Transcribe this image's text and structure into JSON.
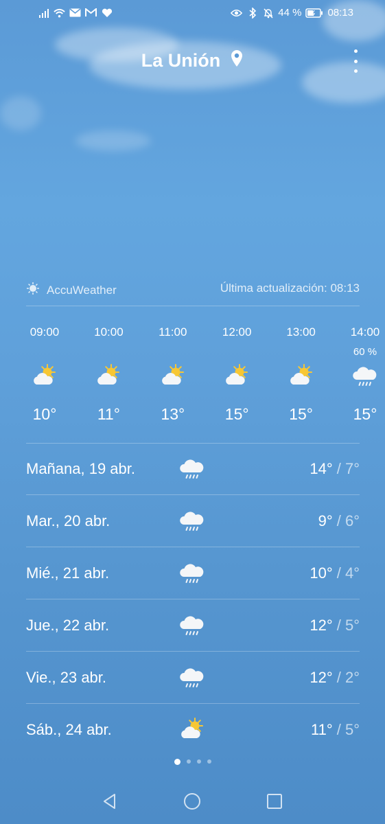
{
  "status_bar": {
    "battery": "44 %",
    "time": "08:13",
    "left_icons": [
      "signal-icon",
      "wifi-icon",
      "mail-icon",
      "gmail-icon",
      "heart-icon"
    ],
    "right_icons": [
      "eye-icon",
      "bluetooth-icon",
      "bell-off-icon",
      "battery-icon"
    ]
  },
  "header": {
    "city": "La Unión",
    "location_icon": "location-pin-icon",
    "menu_icon": "more-vert-icon"
  },
  "provider": {
    "name": "AccuWeather",
    "updated": "Última actualización: 08:13"
  },
  "hourly": [
    {
      "time": "09:00",
      "precip": "",
      "icon": "partly-sunny-icon",
      "temp": "10°"
    },
    {
      "time": "10:00",
      "precip": "",
      "icon": "partly-sunny-icon",
      "temp": "11°"
    },
    {
      "time": "11:00",
      "precip": "",
      "icon": "partly-sunny-icon",
      "temp": "13°"
    },
    {
      "time": "12:00",
      "precip": "",
      "icon": "partly-sunny-icon",
      "temp": "15°"
    },
    {
      "time": "13:00",
      "precip": "",
      "icon": "partly-sunny-icon",
      "temp": "15°"
    },
    {
      "time": "14:00",
      "precip": "60 %",
      "icon": "rain-cloud-icon",
      "temp": "15°"
    }
  ],
  "daily": [
    {
      "label": "Mañana, 19 abr.",
      "icon": "rain-cloud-icon",
      "high": "14°",
      "low": " / 7°"
    },
    {
      "label": "Mar., 20 abr.",
      "icon": "rain-cloud-icon",
      "high": "9°",
      "low": " / 6°"
    },
    {
      "label": "Mié., 21 abr.",
      "icon": "rain-cloud-icon",
      "high": "10°",
      "low": " / 4°"
    },
    {
      "label": "Jue., 22 abr.",
      "icon": "rain-cloud-icon",
      "high": "12°",
      "low": " / 5°"
    },
    {
      "label": "Vie., 23 abr.",
      "icon": "rain-cloud-icon",
      "high": "12°",
      "low": " / 2°"
    },
    {
      "label": "Sáb., 24 abr.",
      "icon": "partly-sunny-icon",
      "high": "11°",
      "low": " / 5°"
    }
  ],
  "pager": {
    "count": 4,
    "active": 0
  },
  "nav": [
    "back-icon",
    "home-icon",
    "recents-icon"
  ]
}
